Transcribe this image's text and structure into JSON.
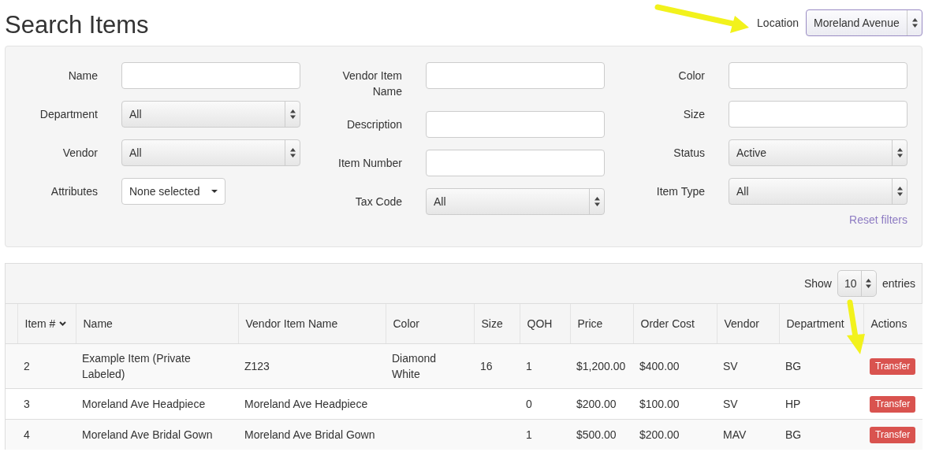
{
  "page": {
    "title": "Search Items"
  },
  "location": {
    "label": "Location",
    "value": "Moreland Avenue"
  },
  "filters": {
    "columns": [
      [
        {
          "kind": "text",
          "label": "Name"
        },
        {
          "kind": "select",
          "label": "Department",
          "value": "All"
        },
        {
          "kind": "select",
          "label": "Vendor",
          "value": "All"
        },
        {
          "kind": "multiselect",
          "label": "Attributes",
          "value": "None selected"
        }
      ],
      [
        {
          "kind": "text",
          "label": "Vendor Item Name"
        },
        {
          "kind": "text",
          "label": "Description"
        },
        {
          "kind": "text",
          "label": "Item Number"
        },
        {
          "kind": "select",
          "label": "Tax Code",
          "value": "All"
        }
      ],
      [
        {
          "kind": "text",
          "label": "Color"
        },
        {
          "kind": "text",
          "label": "Size"
        },
        {
          "kind": "select",
          "label": "Status",
          "value": "Active"
        },
        {
          "kind": "select",
          "label": "Item Type",
          "value": "All"
        }
      ]
    ],
    "reset": "Reset filters"
  },
  "table": {
    "length": {
      "before": "Show",
      "value": "10",
      "after": "entries"
    },
    "columns": [
      {
        "label": "Item #",
        "sorted": true
      },
      {
        "label": "Name",
        "sorted": false
      },
      {
        "label": "Vendor Item Name",
        "sorted": false
      },
      {
        "label": "Color",
        "sorted": false
      },
      {
        "label": "Size",
        "sorted": false
      },
      {
        "label": "QOH",
        "sorted": false
      },
      {
        "label": "Price",
        "sorted": false
      },
      {
        "label": "Order Cost",
        "sorted": false
      },
      {
        "label": "Vendor",
        "sorted": false
      },
      {
        "label": "Department",
        "sorted": false
      },
      {
        "label": "Actions",
        "sorted": false
      }
    ],
    "rows": [
      {
        "item_number": "2",
        "name": "Example Item (Private Labeled)",
        "vendor_item_name": "Z123",
        "item_color": "Diamond White",
        "size": "16",
        "qoh": "1",
        "price": "$1,200.00",
        "order_cost": "$400.00",
        "vendor": "SV",
        "department": "BG",
        "action": "Transfer"
      },
      {
        "item_number": "3",
        "name": "Moreland Ave Headpiece",
        "vendor_item_name": "Moreland Ave Headpiece",
        "qoh": "0",
        "price": "$200.00",
        "order_cost": "$100.00",
        "vendor": "SV",
        "department": "HP",
        "action": "Transfer"
      },
      {
        "item_number": "4",
        "name": "Moreland Ave Bridal Gown",
        "vendor_item_name": "Moreland Ave Bridal Gown",
        "qoh": "1",
        "price": "$500.00",
        "order_cost": "$200.00",
        "vendor": "MAV",
        "department": "BG",
        "action": "Transfer"
      }
    ]
  }
}
